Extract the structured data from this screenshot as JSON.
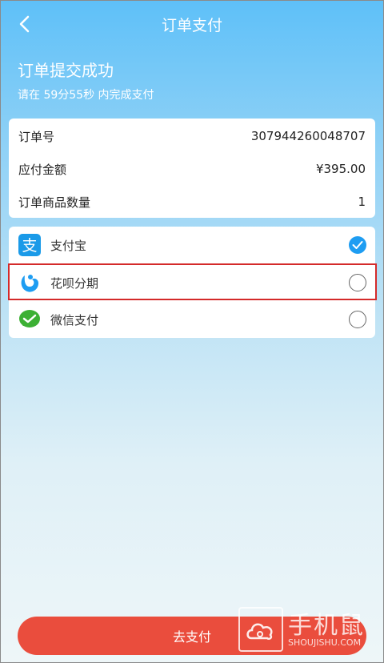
{
  "header": {
    "title": "订单支付"
  },
  "status": {
    "success": "订单提交成功",
    "countdown": "请在 59分55秒 内完成支付"
  },
  "order": {
    "rows": [
      {
        "label": "订单号",
        "value": "307944260048707"
      },
      {
        "label": "应付金额",
        "value": "¥395.00"
      },
      {
        "label": "订单商品数量",
        "value": "1"
      }
    ]
  },
  "payment": {
    "options": [
      {
        "label": "支付宝",
        "icon": "alipay-icon",
        "selected": true
      },
      {
        "label": "花呗分期",
        "icon": "huabei-icon",
        "selected": false
      },
      {
        "label": "微信支付",
        "icon": "wechat-pay-icon",
        "selected": false
      }
    ]
  },
  "footer": {
    "pay_button": "去支付"
  },
  "watermark": {
    "cn": "手机鼠",
    "en": "SHOUJISHU.COM"
  },
  "colors": {
    "accent": "#1e9df2",
    "pay_button": "#ea4d3d",
    "alipay": "#1a9ae8",
    "wechat": "#3cb034",
    "highlight": "#d42a2a"
  }
}
